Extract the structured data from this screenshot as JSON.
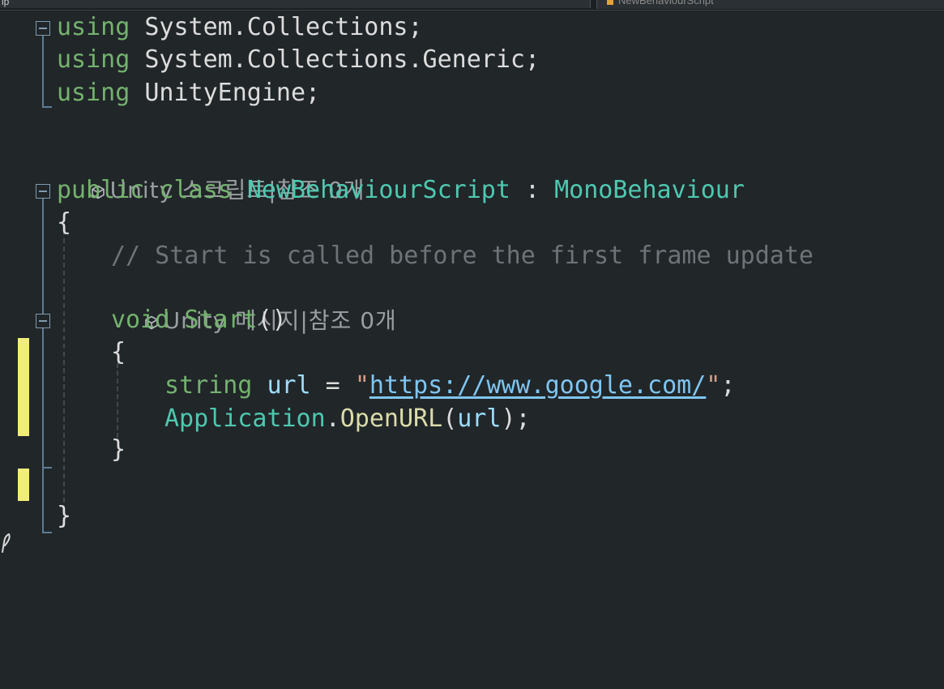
{
  "tabs": {
    "left_label": "ip",
    "right_label": "NewBehaviourScript"
  },
  "code": {
    "using1": {
      "keyword": "using",
      "ns": "System.Collections;"
    },
    "using2": {
      "keyword": "using",
      "ns": "System.Collections.Generic;"
    },
    "using3": {
      "keyword": "using",
      "ns": "UnityEngine;"
    },
    "lens_class": "Unity 스크립트|참조 0개",
    "class_line": {
      "public": "public",
      "class": "class",
      "name": "NewBehaviourScript",
      "colon": " : ",
      "base": "MonoBehaviour"
    },
    "open_brace": "{",
    "comment": "// Start is called before the first frame update",
    "lens_method": "Unity 메시지|참조 0개",
    "method_line": {
      "void": "void",
      "name": "Start",
      "parens": "()"
    },
    "method_open": "{",
    "stmt1": {
      "type": "string",
      "var": "url",
      "eq": " = ",
      "quote_open": "\"",
      "url": "https://www.google.com/",
      "quote_close": "\"",
      "semi": ";"
    },
    "stmt2": {
      "cls": "Application",
      "dot": ".",
      "fn": "OpenURL",
      "lp": "(",
      "arg": "url",
      "rp": ");"
    },
    "method_close": "}",
    "class_close": "}"
  },
  "colors": {
    "background": "#212629",
    "keyword": "#74b26e",
    "type": "#4ec9b0",
    "comment": "#6e7378",
    "change_marker": "#f0ee79"
  }
}
